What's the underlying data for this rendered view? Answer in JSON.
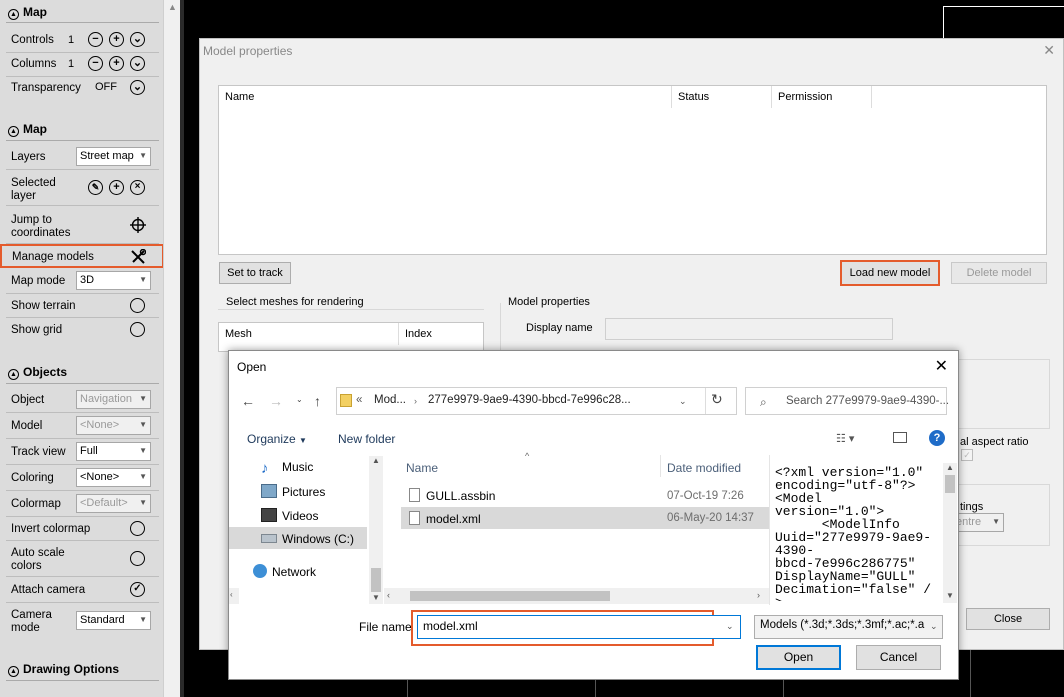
{
  "sidebar": {
    "section_map1": "Map",
    "controls_label": "Controls",
    "controls_value": "1",
    "columns_label": "Columns",
    "columns_value": "1",
    "transparency_label": "Transparency",
    "transparency_value": "OFF",
    "section_map2": "Map",
    "layers_label": "Layers",
    "layers_value": "Street map",
    "selected_layer_label": "Selected\nlayer",
    "jump_label": "Jump to\ncoordinates",
    "manage_models_label": "Manage models",
    "map_mode_label": "Map mode",
    "map_mode_value": "3D",
    "show_terrain_label": "Show terrain",
    "show_grid_label": "Show grid",
    "section_objects": "Objects",
    "object_label": "Object",
    "object_value": "Navigation",
    "model_label": "Model",
    "model_value": "<None>",
    "track_view_label": "Track view",
    "track_view_value": "Full",
    "coloring_label": "Coloring",
    "coloring_value": "<None>",
    "colormap_label": "Colormap",
    "colormap_value": "<Default>",
    "invert_colormap_label": "Invert colormap",
    "auto_scale_label": "Auto scale\ncolors",
    "attach_camera_label": "Attach camera",
    "camera_mode_label": "Camera\nmode",
    "camera_mode_value": "Standard",
    "section_drawing": "Drawing Options"
  },
  "model_props": {
    "title": "Model properties",
    "col_name": "Name",
    "col_status": "Status",
    "col_permission": "Permission",
    "set_to_track": "Set to track",
    "load_new_model": "Load new model",
    "delete_model": "Delete model",
    "meshes_label": "Select meshes for rendering",
    "mesh_col": "Mesh",
    "index_col": "Index",
    "props_group": "Model properties",
    "display_name_label": "Display name",
    "aspect_partial": "al aspect ratio",
    "settings_partial": "tings",
    "centre_partial": "entre",
    "close": "Close"
  },
  "open_dialog": {
    "title": "Open",
    "crumb1": "Mod...",
    "crumb2": "277e9979-9ae9-4390-bbcd-7e996c28...",
    "search_placeholder": "Search 277e9979-9ae9-4390-...",
    "organize": "Organize",
    "new_folder": "New folder",
    "nav": [
      "Music",
      "Pictures",
      "Videos",
      "Windows (C:)",
      "Network"
    ],
    "hdr_name": "Name",
    "hdr_date": "Date modified",
    "files": [
      {
        "name": "GULL.assbin",
        "date": "07-Oct-19 7:26"
      },
      {
        "name": "model.xml",
        "date": "06-May-20 14:37"
      }
    ],
    "preview_text": "<?xml version=\"1.0\"\nencoding=\"utf-8\"?>\n<Model\nversion=\"1.0\">\n      <ModelInfo\nUuid=\"277e9979-9ae9-\n4390-\nbbcd-7e996c286775\"\nDisplayName=\"GULL\"\nDecimation=\"false\" /\n>",
    "file_name_label": "File name",
    "file_name_value": "model.xml",
    "filter_value": "Models (*.3d;*.3ds;*.3mf;*.ac;*.a",
    "open_btn": "Open",
    "cancel_btn": "Cancel"
  },
  "colors": {
    "highlight": "#e45b2c",
    "accent": "#0078d7"
  }
}
